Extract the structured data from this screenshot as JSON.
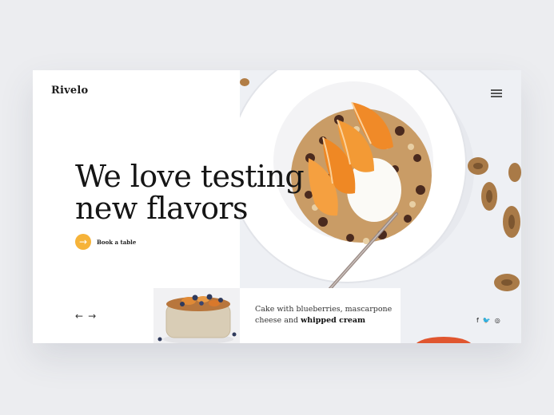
{
  "brand": {
    "logo": "Rivelo"
  },
  "nav": {
    "menu_icon": "hamburger-menu-icon"
  },
  "hero": {
    "headline_line1": "We love testing",
    "headline_line2": "new flavors",
    "cta_label": "Book a table",
    "cta_icon": "arrow-right-icon"
  },
  "slider": {
    "prev_icon": "←",
    "next_icon": "→"
  },
  "featured": {
    "text_part1": "Cake with blueberries, mascarpone",
    "text_part2": "cheese and ",
    "text_bold": "whipped cream"
  },
  "social": {
    "facebook": "f",
    "twitter": "🐦",
    "instagram": "◎"
  },
  "colors": {
    "accent": "#f6b339",
    "card_bg": "#ffffff",
    "page_bg": "#ecedf0"
  }
}
